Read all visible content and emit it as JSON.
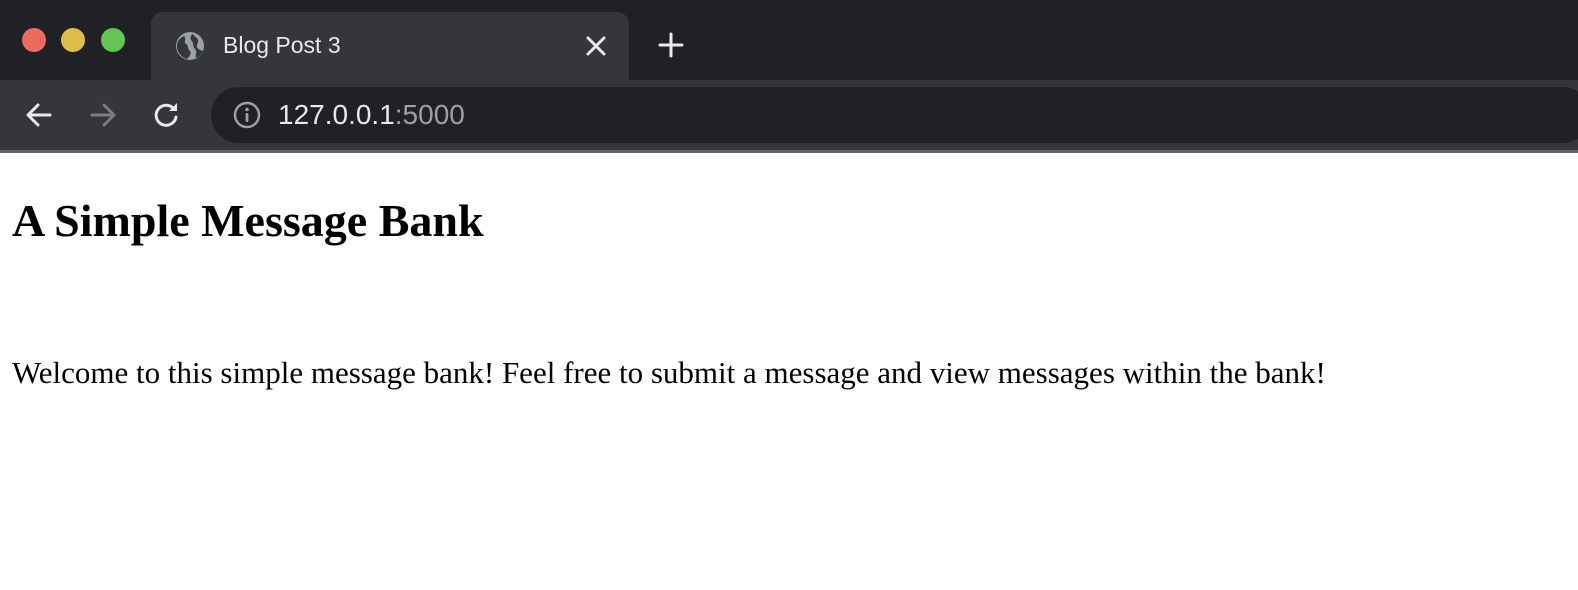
{
  "browser": {
    "tab": {
      "title": "Blog Post 3",
      "favicon": "globe-icon"
    },
    "address_bar": {
      "host": "127.0.0.1",
      "port": ":5000"
    },
    "colors": {
      "tabstrip": "#202124",
      "toolbar": "#35363a",
      "text": "#e8eaed",
      "muted": "#9aa0a6"
    }
  },
  "page": {
    "heading": "A Simple Message Bank",
    "intro": "Welcome to this simple message bank! Feel free to submit a message and view messages within the bank!"
  }
}
